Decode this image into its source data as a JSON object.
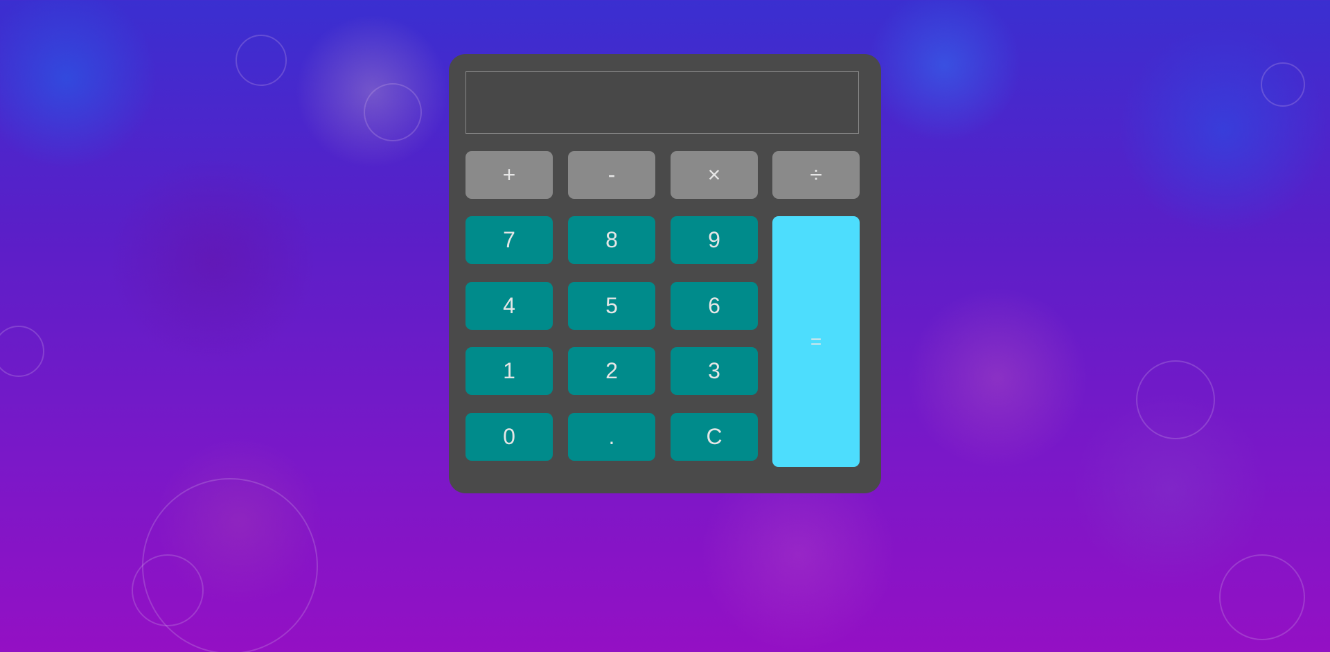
{
  "display": {
    "value": ""
  },
  "operators": [
    {
      "key": "add",
      "label": "+"
    },
    {
      "key": "subtract",
      "label": "-"
    },
    {
      "key": "multiply",
      "label": "×"
    },
    {
      "key": "divide",
      "label": "÷"
    }
  ],
  "digits": {
    "seven": "7",
    "eight": "8",
    "nine": "9",
    "four": "4",
    "five": "5",
    "six": "6",
    "one": "1",
    "two": "2",
    "three": "3",
    "zero": "0",
    "decimal": ".",
    "clear": "C"
  },
  "equals": {
    "label": "="
  },
  "colors": {
    "panel": "#4a4a4a",
    "operator_button": "#8a8a8a",
    "number_button": "#008b8b",
    "equals_button": "#4dddfd",
    "button_text": "#e6e6e6"
  }
}
